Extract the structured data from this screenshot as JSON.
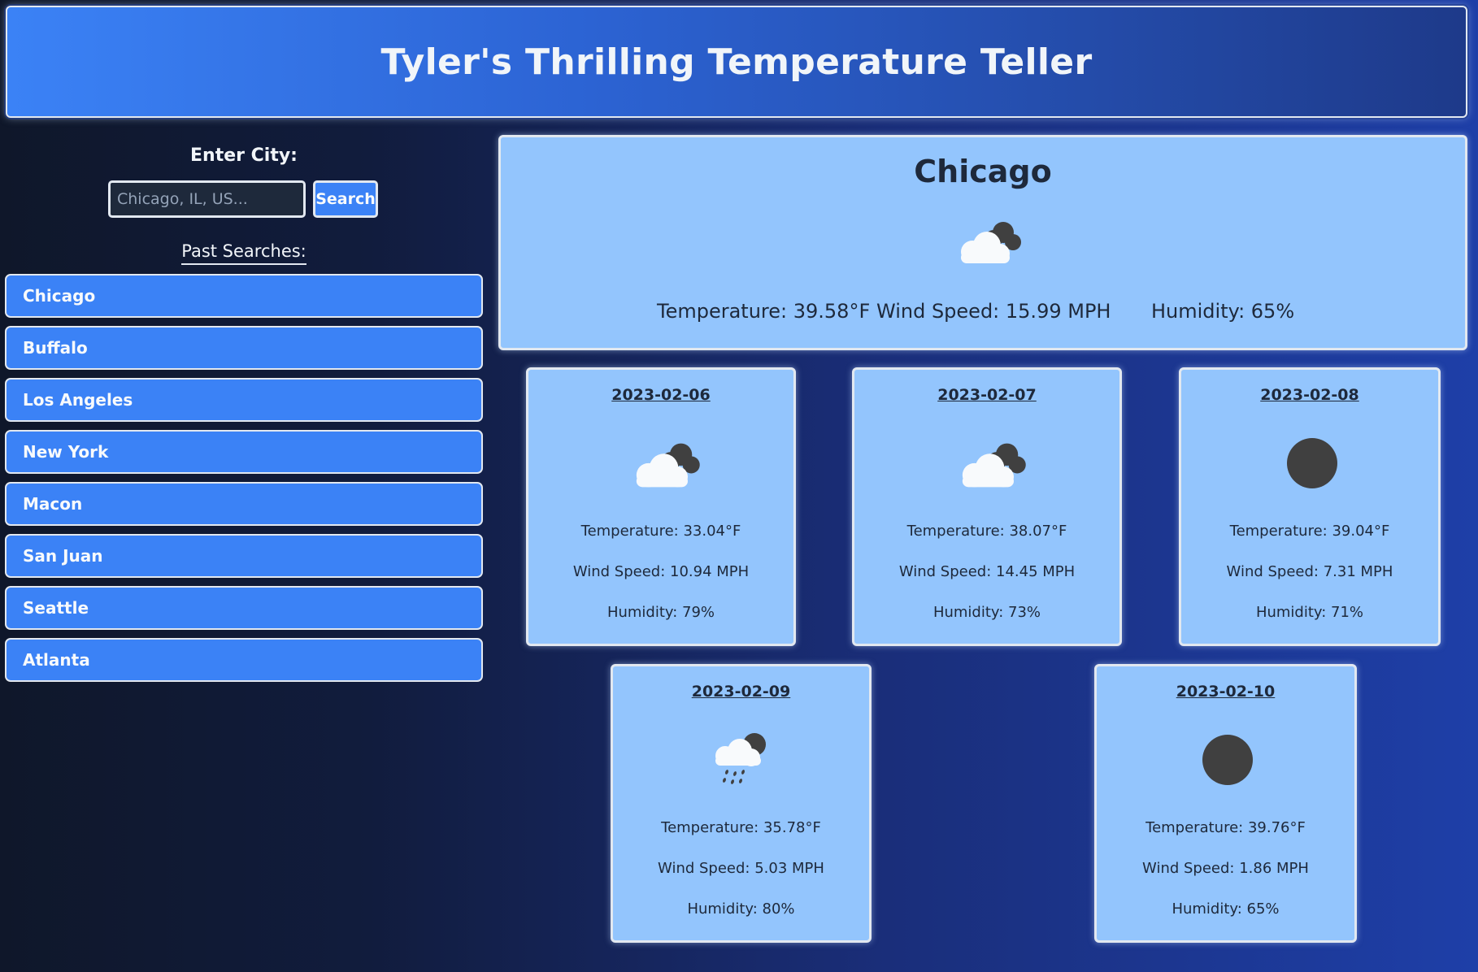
{
  "header": {
    "title": "Tyler's Thrilling Temperature Teller"
  },
  "search": {
    "label": "Enter City:",
    "placeholder": "Chicago, IL, US...",
    "button_label": "Search"
  },
  "past_searches": {
    "label": "Past Searches:",
    "items": [
      {
        "label": "Chicago"
      },
      {
        "label": "Buffalo"
      },
      {
        "label": "Los Angeles"
      },
      {
        "label": "New York"
      },
      {
        "label": "Macon"
      },
      {
        "label": "San Juan"
      },
      {
        "label": "Seattle"
      },
      {
        "label": "Atlanta"
      }
    ]
  },
  "current": {
    "city": "Chicago",
    "icon": "cloudy-icon",
    "temperature": "Temperature: 39.58°F",
    "wind": "Wind Speed: 15.99 MPH",
    "humidity": "Humidity: 65%"
  },
  "forecast": [
    {
      "date": "2023-02-06",
      "icon": "cloudy-icon",
      "temperature": "Temperature: 33.04°F",
      "wind": "Wind Speed: 10.94 MPH",
      "humidity": "Humidity: 79%"
    },
    {
      "date": "2023-02-07",
      "icon": "cloudy-icon",
      "temperature": "Temperature: 38.07°F",
      "wind": "Wind Speed: 14.45 MPH",
      "humidity": "Humidity: 73%"
    },
    {
      "date": "2023-02-08",
      "icon": "clear-night-icon",
      "temperature": "Temperature: 39.04°F",
      "wind": "Wind Speed: 7.31 MPH",
      "humidity": "Humidity: 71%"
    },
    {
      "date": "2023-02-09",
      "icon": "rain-icon",
      "temperature": "Temperature: 35.78°F",
      "wind": "Wind Speed: 5.03 MPH",
      "humidity": "Humidity: 80%"
    },
    {
      "date": "2023-02-10",
      "icon": "clear-night-icon",
      "temperature": "Temperature: 39.76°F",
      "wind": "Wind Speed: 1.86 MPH",
      "humidity": "Humidity: 65%"
    }
  ],
  "colors": {
    "accent": "#3b82f6",
    "card": "#93c5fd",
    "text_dark": "#1e293b",
    "icon_dark": "#404040"
  }
}
